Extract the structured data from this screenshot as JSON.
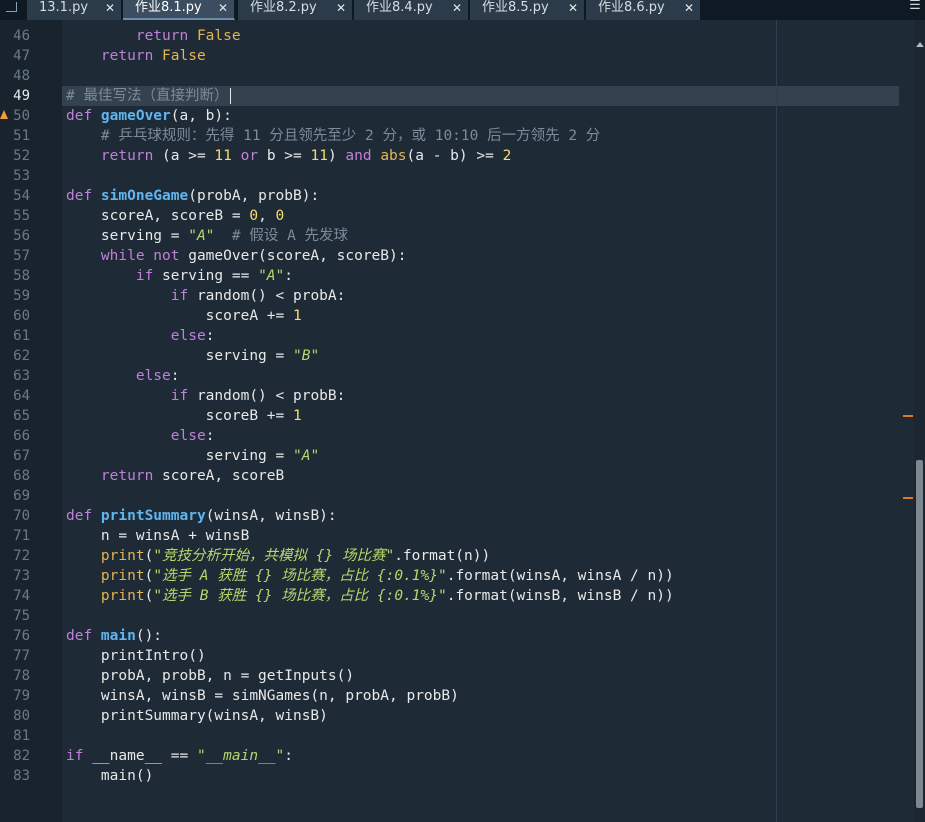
{
  "tabs": [
    {
      "label": "13.1.py",
      "close": "✕"
    },
    {
      "label": "作业8.1.py",
      "close": "✕"
    },
    {
      "label": "作业8.2.py",
      "close": "✕"
    },
    {
      "label": "作业8.4.py",
      "close": "✕"
    },
    {
      "label": "作业8.5.py",
      "close": "✕"
    },
    {
      "label": "作业8.6.py",
      "close": "✕"
    }
  ],
  "active_tab": "作业8.1.py",
  "menu_icon": "☰",
  "colors": {
    "keyword": "#c080d8",
    "function": "#5fb6f0",
    "builtin": "#e6b450",
    "number": "#f7dc6f",
    "string": "#b5d86b",
    "comment": "#7d8c99",
    "warning": "#f0a030"
  },
  "lines": [
    {
      "n": "46",
      "t": [
        [
          "kw",
          "        return "
        ],
        [
          "bi",
          "False"
        ]
      ]
    },
    {
      "n": "47",
      "t": [
        [
          "kw",
          "    return "
        ],
        [
          "bi",
          "False"
        ]
      ]
    },
    {
      "n": "48",
      "t": []
    },
    {
      "n": "49",
      "t": [
        [
          "cmt",
          "# 最佳写法（直接判断）"
        ]
      ],
      "cursor": true
    },
    {
      "n": "50",
      "t": [
        [
          "kw",
          "def "
        ],
        [
          "fn",
          "gameOver"
        ],
        [
          "op",
          "(a, b):"
        ]
      ],
      "warning": true
    },
    {
      "n": "51",
      "t": [
        [
          "cmt",
          "    # 乒乓球规则：先得 11 分且领先至少 2 分，或 10:10 后一方领先 2 分"
        ]
      ]
    },
    {
      "n": "52",
      "t": [
        [
          "kw",
          "    return "
        ],
        [
          "op",
          "(a >= "
        ],
        [
          "num",
          "11"
        ],
        [
          "kw",
          " or "
        ],
        [
          "op",
          "b >= "
        ],
        [
          "num",
          "11"
        ],
        [
          "op",
          ") "
        ],
        [
          "kw",
          "and "
        ],
        [
          "bi",
          "abs"
        ],
        [
          "op",
          "(a - b) >= "
        ],
        [
          "num",
          "2"
        ]
      ]
    },
    {
      "n": "53",
      "t": []
    },
    {
      "n": "54",
      "t": [
        [
          "kw",
          "def "
        ],
        [
          "fn",
          "simOneGame"
        ],
        [
          "op",
          "(probA, probB):"
        ]
      ]
    },
    {
      "n": "55",
      "t": [
        [
          "op",
          "    scoreA, scoreB = "
        ],
        [
          "num",
          "0"
        ],
        [
          "op",
          ", "
        ],
        [
          "num",
          "0"
        ]
      ]
    },
    {
      "n": "56",
      "t": [
        [
          "op",
          "    serving = "
        ],
        [
          "str",
          "\"A\""
        ],
        [
          "cmt",
          "  # 假设 A 先发球"
        ]
      ]
    },
    {
      "n": "57",
      "t": [
        [
          "kw",
          "    while not "
        ],
        [
          "op",
          "gameOver(scoreA, scoreB):"
        ]
      ]
    },
    {
      "n": "58",
      "t": [
        [
          "kw",
          "        if "
        ],
        [
          "op",
          "serving == "
        ],
        [
          "str",
          "\"A\""
        ],
        [
          "op",
          ":"
        ]
      ]
    },
    {
      "n": "59",
      "t": [
        [
          "kw",
          "            if "
        ],
        [
          "op",
          "random() < probA:"
        ]
      ]
    },
    {
      "n": "60",
      "t": [
        [
          "op",
          "                scoreA += "
        ],
        [
          "num",
          "1"
        ]
      ]
    },
    {
      "n": "61",
      "t": [
        [
          "kw",
          "            else"
        ],
        [
          "op",
          ":"
        ]
      ]
    },
    {
      "n": "62",
      "t": [
        [
          "op",
          "                serving = "
        ],
        [
          "str",
          "\"B\""
        ]
      ]
    },
    {
      "n": "63",
      "t": [
        [
          "kw",
          "        else"
        ],
        [
          "op",
          ":"
        ]
      ]
    },
    {
      "n": "64",
      "t": [
        [
          "kw",
          "            if "
        ],
        [
          "op",
          "random() < probB:"
        ]
      ]
    },
    {
      "n": "65",
      "t": [
        [
          "op",
          "                scoreB += "
        ],
        [
          "num",
          "1"
        ]
      ]
    },
    {
      "n": "66",
      "t": [
        [
          "kw",
          "            else"
        ],
        [
          "op",
          ":"
        ]
      ]
    },
    {
      "n": "67",
      "t": [
        [
          "op",
          "                serving = "
        ],
        [
          "str",
          "\"A\""
        ]
      ]
    },
    {
      "n": "68",
      "t": [
        [
          "kw",
          "    return "
        ],
        [
          "op",
          "scoreA, scoreB"
        ]
      ]
    },
    {
      "n": "69",
      "t": []
    },
    {
      "n": "70",
      "t": [
        [
          "kw",
          "def "
        ],
        [
          "fn",
          "printSummary"
        ],
        [
          "op",
          "(winsA, winsB):"
        ]
      ]
    },
    {
      "n": "71",
      "t": [
        [
          "op",
          "    n = winsA + winsB"
        ]
      ]
    },
    {
      "n": "72",
      "t": [
        [
          "bi",
          "    print"
        ],
        [
          "op",
          "("
        ],
        [
          "str",
          "\"竞技分析开始，共模拟 {} 场比赛\""
        ],
        [
          "op",
          ".format(n))"
        ]
      ]
    },
    {
      "n": "73",
      "t": [
        [
          "bi",
          "    print"
        ],
        [
          "op",
          "("
        ],
        [
          "str",
          "\"选手 A 获胜 {} 场比赛，占比 {:0.1%}\""
        ],
        [
          "op",
          ".format(winsA, winsA / n))"
        ]
      ]
    },
    {
      "n": "74",
      "t": [
        [
          "bi",
          "    print"
        ],
        [
          "op",
          "("
        ],
        [
          "str",
          "\"选手 B 获胜 {} 场比赛，占比 {:0.1%}\""
        ],
        [
          "op",
          ".format(winsB, winsB / n))"
        ]
      ]
    },
    {
      "n": "75",
      "t": []
    },
    {
      "n": "76",
      "t": [
        [
          "kw",
          "def "
        ],
        [
          "fn",
          "main"
        ],
        [
          "op",
          "():"
        ]
      ]
    },
    {
      "n": "77",
      "t": [
        [
          "op",
          "    printIntro()"
        ]
      ]
    },
    {
      "n": "78",
      "t": [
        [
          "op",
          "    probA, probB, n = getInputs()"
        ]
      ]
    },
    {
      "n": "79",
      "t": [
        [
          "op",
          "    winsA, winsB = simNGames(n, probA, probB)"
        ]
      ]
    },
    {
      "n": "80",
      "t": [
        [
          "op",
          "    printSummary(winsA, winsB)"
        ]
      ]
    },
    {
      "n": "81",
      "t": []
    },
    {
      "n": "82",
      "t": [
        [
          "kw",
          "if "
        ],
        [
          "op",
          "__name__ == "
        ],
        [
          "str",
          "\"__main__\""
        ],
        [
          "op",
          ":"
        ]
      ]
    },
    {
      "n": "83",
      "t": [
        [
          "op",
          "    main()"
        ]
      ]
    }
  ]
}
